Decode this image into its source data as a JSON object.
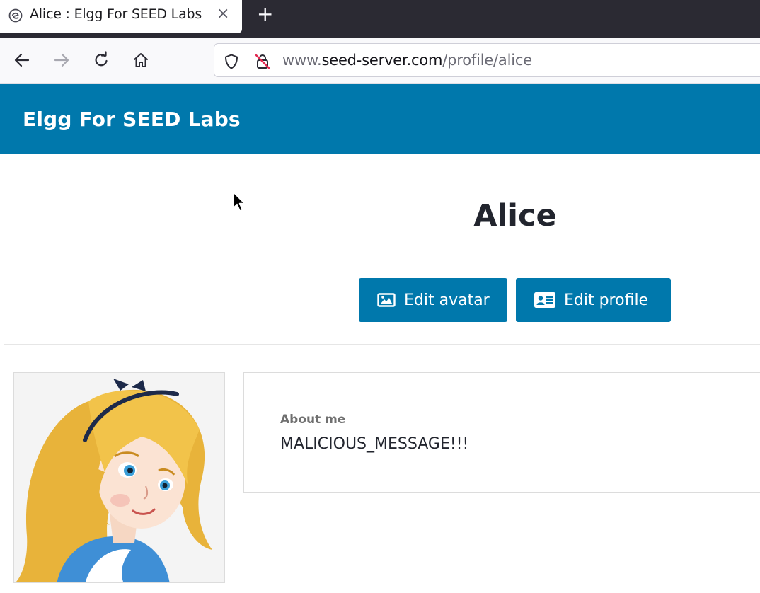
{
  "browser": {
    "tab_title": "Alice : Elgg For SEED Labs",
    "tab_close": "×",
    "new_tab": "+",
    "url_prefix": "www.",
    "url_host": "seed-server.com",
    "url_path": "/profile/alice"
  },
  "site": {
    "title": "Elgg For SEED Labs",
    "brand_color": "#0078ac"
  },
  "profile": {
    "name": "Alice",
    "edit_avatar_label": "Edit avatar",
    "edit_profile_label": "Edit profile",
    "about_label": "About me",
    "about_value": "MALICIOUS_MESSAGE!!!"
  },
  "icons": {
    "tab": "elgg-favicon-icon",
    "back": "arrow-left-icon",
    "forward": "arrow-right-icon",
    "reload": "reload-icon",
    "home": "home-icon",
    "shield": "shield-icon",
    "insecure": "insecure-lock-icon",
    "edit_avatar": "image-icon",
    "edit_profile": "id-card-icon",
    "cursor": "mouse-pointer-icon"
  }
}
